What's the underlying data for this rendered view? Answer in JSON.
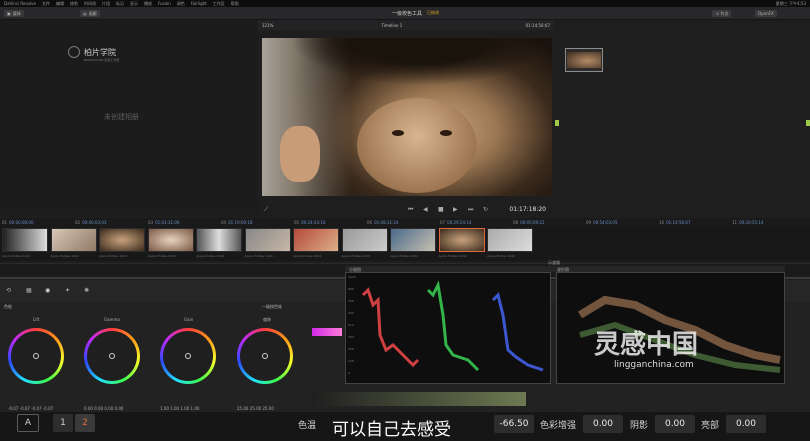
{
  "macbar": {
    "app": "DaVinci Resolve",
    "menus": [
      "文件",
      "编辑",
      "修剪",
      "时间线",
      "片段",
      "标记",
      "显示",
      "播放",
      "Fusion",
      "调色",
      "Fairlight",
      "工作区",
      "帮助"
    ],
    "right": "星期三 下午4:53"
  },
  "toolbar": {
    "media_label": "媒体",
    "gallery_label": "画廊",
    "zoom": "121%",
    "timeline_name": "Timeline 1",
    "timecode": "01:14:56:07",
    "nodes_label": "节点",
    "openfx_label": "OpenFX",
    "key_label": "键帧"
  },
  "window": {
    "title": "一级校色工具",
    "subtitle": "已修改"
  },
  "left_panel": {
    "empty_text": "未创建相册",
    "logo_text": "柏片学院",
    "logo_sub": "BEDIAN.COM 影视工作室"
  },
  "viewer": {
    "timecode": "01:17:18:20"
  },
  "timeline_items": [
    {
      "num": "01",
      "tc": "00:00:00:00"
    },
    {
      "num": "02",
      "tc": "00:40:03:03"
    },
    {
      "num": "03",
      "tc": "01:01:31:06"
    },
    {
      "num": "04",
      "tc": "01:19:00:18"
    },
    {
      "num": "05",
      "tc": "00:24:43:16"
    },
    {
      "num": "06",
      "tc": "01:08:31:24"
    },
    {
      "num": "07",
      "tc": "00:29:24:14"
    },
    {
      "num": "08",
      "tc": "00:05:09:22"
    },
    {
      "num": "09",
      "tc": "00:54:03:05"
    },
    {
      "num": "10",
      "tc": "01:14:56:07"
    },
    {
      "num": "11",
      "tc": "00:20:55:14"
    }
  ],
  "clip_codec": "Apple ProRes 4444",
  "panels": {
    "primaries_label": "一级校色轮",
    "color_label": "色轮",
    "scopes_label": "示波器",
    "waveform_label": "分量图",
    "waveform2_label": "波形图"
  },
  "wheels": [
    {
      "name": "Lift",
      "values": "-0.07  -0.07  -0.07  -0.07"
    },
    {
      "name": "Gamma",
      "values": "0.00  0.00  0.00  0.00"
    },
    {
      "name": "Gain",
      "values": "1.00  1.00  1.00  1.00"
    },
    {
      "name": "偏移",
      "values": "25.00  25.00  25.00"
    }
  ],
  "scope_scale": [
    "1023",
    "896",
    "768",
    "640",
    "512",
    "384",
    "256",
    "128",
    "0"
  ],
  "subtitle": "可以自己去感受",
  "bottom_controls": {
    "a_label": "A",
    "page1": "1",
    "page2": "2",
    "color_temp_label": "色温",
    "color_temp_value": "-66.50",
    "color_boost_label": "色彩增强",
    "color_boost_value": "0.00",
    "shadow_label": "阴影",
    "shadow_value": "0.00",
    "highlight_label": "亮部",
    "highlight_value": "0.00"
  },
  "watermark": {
    "main": "灵感中国",
    "sub": "lingganchina.com"
  },
  "colors": {
    "accent": "#d8a72c",
    "active_page": "#e06a3c",
    "timecode_blue": "#6a8fc4"
  }
}
